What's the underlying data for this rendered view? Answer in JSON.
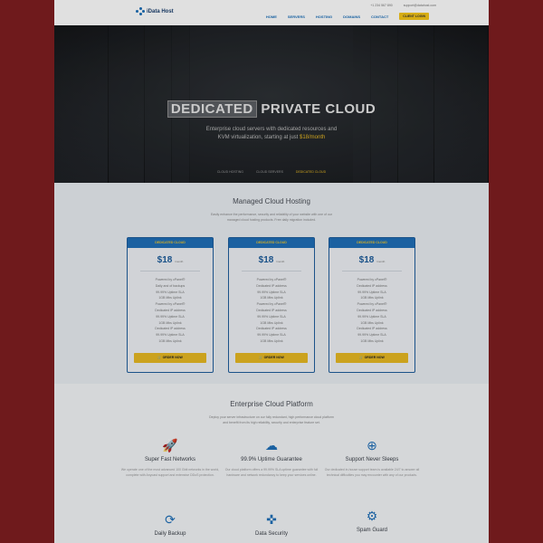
{
  "header": {
    "logo_text": "iData Host",
    "phone": "+1 234 567 890",
    "email": "support@datahost.com",
    "nav": [
      "HOME",
      "SERVERS",
      "HOSTING",
      "DOMAINS",
      "CONTACT"
    ],
    "login": "CLIENT LOGIN"
  },
  "hero": {
    "title_boxed": "DEDICATED",
    "title_rest": "PRIVATE CLOUD",
    "subtitle_line1": "Enterprise cloud servers with dedicated resources and",
    "subtitle_line2": "KVM virtualization, starting at just",
    "price": "$18/month",
    "tabs": [
      "CLOUD HOSTING",
      "CLOUD SERVERS",
      "DEDICATED CLOUD"
    ]
  },
  "pricing": {
    "title": "Managed Cloud Hosting",
    "desc_line1": "Easily enhance the performance, security and reliability of your website with one of our",
    "desc_line2": "managed cloud hosting products. Free daily migration included.",
    "plans": [
      {
        "head": "DEDICATED CLOUD",
        "price": "$18",
        "period": "/month",
        "features": [
          "Powered by cPanel®",
          "Daily and of backups",
          "99.99% Uptime SLA",
          "1GB Mbs Uplink",
          "Powered by cPanel®",
          "Dedicated IP address",
          "99.99% Uptime SLA",
          "1GB Mbs Uplink",
          "Dedicated IP address",
          "99.99% Uptime SLA",
          "1GB Mbs Uplink"
        ],
        "button": "ORDER NOW"
      },
      {
        "head": "DEDICATED CLOUD",
        "price": "$18",
        "period": "/month",
        "features": [
          "Powered by cPanel®",
          "Dedicated IP address",
          "99.99% Uptime SLA",
          "1GB Mbs Uplink",
          "Powered by cPanel®",
          "Dedicated IP address",
          "99.99% Uptime SLA",
          "1GB Mbs Uplink",
          "Dedicated IP address",
          "99.99% Uptime SLA",
          "1GB Mbs Uplink"
        ],
        "button": "ORDER NOW"
      },
      {
        "head": "DEDICATED CLOUD",
        "price": "$18",
        "period": "/month",
        "features": [
          "Powered by cPanel®",
          "Dedicated IP address",
          "99.99% Uptime SLA",
          "1GB Mbs Uplink",
          "Powered by cPanel®",
          "Dedicated IP address",
          "99.99% Uptime SLA",
          "1GB Mbs Uplink",
          "Dedicated IP address",
          "99.99% Uptime SLA",
          "1GB Mbs Uplink"
        ],
        "button": "ORDER NOW"
      }
    ]
  },
  "platform": {
    "title": "Enterprise Cloud Platform",
    "desc_line1": "Deploy your server infrastructure on our fully redundant, high performance cloud platform",
    "desc_line2": "and benefit from its high reliability, security and enterprise feature set.",
    "items": [
      {
        "icon": "rocket-icon",
        "glyph": "🚀",
        "title": "Super Fast Networks",
        "desc": "We operate one of the most advanced 100 Gbit networks in the world, complete with Anycast support and extensive DDoS protection."
      },
      {
        "icon": "cloud-icon",
        "glyph": "☁",
        "title": "99.9% Uptime Guarantee",
        "desc": "Our cloud platform offers a 99.99% SLA uptime guarantee with full hardware and network redundancy to keep your services online."
      },
      {
        "icon": "lifebuoy-icon",
        "glyph": "⊕",
        "title": "Support Never Sleeps",
        "desc": "Our dedicated in-house support team is available 24/7 to answer all technical difficulties you may encounter with any of our products."
      },
      {
        "icon": "refresh-icon",
        "glyph": "⟳",
        "title": "Daily Backup",
        "desc": ""
      },
      {
        "icon": "shield-icon",
        "glyph": "✜",
        "title": "Data Security",
        "desc": ""
      },
      {
        "icon": "gear-icon",
        "glyph": "⚙",
        "title": "Spam Guard",
        "desc": ""
      }
    ]
  },
  "colors": {
    "accent": "#1f6fb8",
    "highlight": "#e8b923",
    "frame": "#6f1a1c"
  }
}
